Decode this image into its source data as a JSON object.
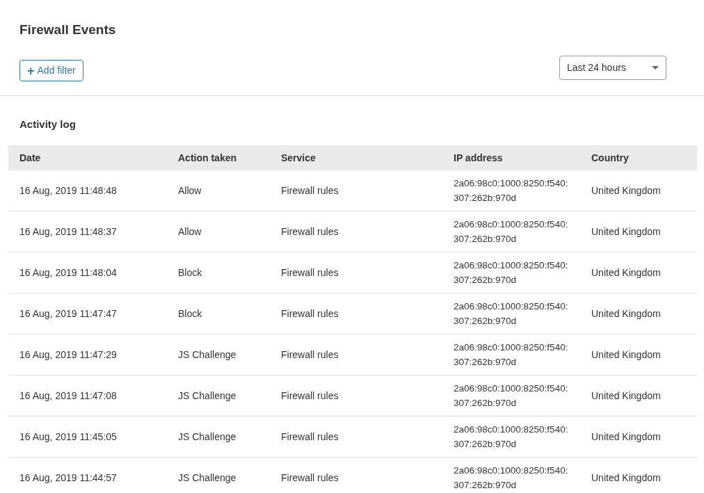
{
  "page": {
    "title": "Firewall Events"
  },
  "toolbar": {
    "add_filter": {
      "icon": "+",
      "label": "Add filter"
    },
    "time_range": {
      "value": "Last 24 hours"
    }
  },
  "activity_log": {
    "title": "Activity log",
    "columns": [
      "Date",
      "Action taken",
      "Service",
      "IP address",
      "Country"
    ],
    "rows": [
      {
        "date": "16 Aug, 2019 11:48:48",
        "action": "Allow",
        "service": "Firewall rules",
        "ip": "2a06:98c0:1000:8250:f540:307:262b:970d",
        "country": "United Kingdom"
      },
      {
        "date": "16 Aug, 2019 11:48:37",
        "action": "Allow",
        "service": "Firewall rules",
        "ip": "2a06:98c0:1000:8250:f540:307:262b:970d",
        "country": "United Kingdom"
      },
      {
        "date": "16 Aug, 2019 11:48:04",
        "action": "Block",
        "service": "Firewall rules",
        "ip": "2a06:98c0:1000:8250:f540:307:262b:970d",
        "country": "United Kingdom"
      },
      {
        "date": "16 Aug, 2019 11:47:47",
        "action": "Block",
        "service": "Firewall rules",
        "ip": "2a06:98c0:1000:8250:f540:307:262b:970d",
        "country": "United Kingdom"
      },
      {
        "date": "16 Aug, 2019 11:47:29",
        "action": "JS Challenge",
        "service": "Firewall rules",
        "ip": "2a06:98c0:1000:8250:f540:307:262b:970d",
        "country": "United Kingdom"
      },
      {
        "date": "16 Aug, 2019 11:47:08",
        "action": "JS Challenge",
        "service": "Firewall rules",
        "ip": "2a06:98c0:1000:8250:f540:307:262b:970d",
        "country": "United Kingdom"
      },
      {
        "date": "16 Aug, 2019 11:45:05",
        "action": "JS Challenge",
        "service": "Firewall rules",
        "ip": "2a06:98c0:1000:8250:f540:307:262b:970d",
        "country": "United Kingdom"
      },
      {
        "date": "16 Aug, 2019 11:44:57",
        "action": "JS Challenge",
        "service": "Firewall rules",
        "ip": "2a06:98c0:1000:8250:f540:307:262b:970d",
        "country": "United Kingdom"
      }
    ]
  }
}
